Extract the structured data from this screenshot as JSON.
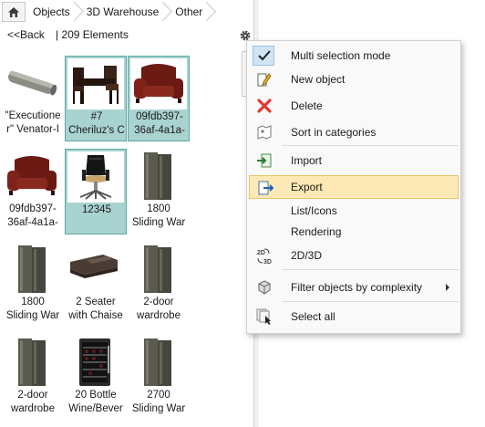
{
  "breadcrumb": [
    "Objects",
    "3D Warehouse",
    "Other"
  ],
  "header": {
    "back_label": "<<Back",
    "count_label": "| 209 Elements"
  },
  "grid": [
    {
      "caption_lines": [
        "\"Executione",
        "r\"  Venator-I"
      ],
      "selected": false,
      "icon": "pipe-icon"
    },
    {
      "caption_lines": [
        "#7",
        "Cheriluz's C"
      ],
      "selected": true,
      "icon": "table-chairs-icon"
    },
    {
      "caption_lines": [
        "09fdb397-",
        "36af-4a1a-"
      ],
      "selected": true,
      "icon": "armchair-icon"
    },
    {
      "caption_lines": [
        "09fdb397-",
        "36af-4a1a-"
      ],
      "selected": false,
      "icon": "armchair-icon"
    },
    {
      "caption_lines": [
        "12345"
      ],
      "selected": true,
      "icon": "office-chair-icon"
    },
    {
      "caption_lines": [
        "1800",
        "Sliding War"
      ],
      "selected": false,
      "icon": "wardrobe-icon"
    },
    {
      "caption_lines": [
        "1800",
        "Sliding War"
      ],
      "selected": false,
      "icon": "wardrobe-icon"
    },
    {
      "caption_lines": [
        "2 Seater",
        "with Chaise"
      ],
      "selected": false,
      "icon": "sofa-icon"
    },
    {
      "caption_lines": [
        "2-door",
        "wardrobe"
      ],
      "selected": false,
      "icon": "wardrobe-icon"
    },
    {
      "caption_lines": [
        "2-door",
        "wardrobe"
      ],
      "selected": false,
      "icon": "wardrobe-icon"
    },
    {
      "caption_lines": [
        "20 Bottle",
        "Wine/Bever"
      ],
      "selected": false,
      "icon": "wine-fridge-icon"
    },
    {
      "caption_lines": [
        "2700",
        "Sliding War"
      ],
      "selected": false,
      "icon": "wardrobe-icon"
    }
  ],
  "menu": {
    "items": [
      {
        "label": "Multi selection mode",
        "icon": "checkmark-icon",
        "checked": true
      },
      {
        "label": "New object",
        "icon": "new-object-icon"
      },
      {
        "label": "Delete",
        "icon": "delete-icon"
      },
      {
        "label": "Sort in categories",
        "icon": "sort-categories-icon"
      },
      {
        "label": "Import",
        "icon": "import-icon"
      },
      {
        "label": "Export",
        "icon": "export-icon",
        "highlighted": true
      },
      {
        "label": "List/Icons",
        "icon": ""
      },
      {
        "label": "Rendering",
        "icon": ""
      },
      {
        "label": "2D/3D",
        "icon": "2d-3d-icon",
        "icon_text_top": "2D",
        "icon_text_bottom": "3D"
      },
      {
        "label": "Filter objects by complexity",
        "icon": "filter-complexity-icon",
        "has_submenu": true
      },
      {
        "label": "Select all",
        "icon": "select-all-icon"
      }
    ]
  },
  "colors": {
    "selected_bg": "#a9d3d0",
    "highlight_bg": "#fde9b5",
    "delete_red": "#e2382f"
  }
}
